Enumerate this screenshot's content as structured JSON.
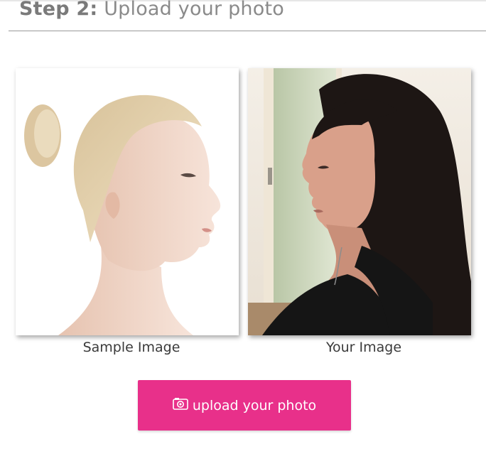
{
  "header": {
    "step_label": "Step 2:",
    "step_text": "Upload your photo"
  },
  "photos": {
    "sample": {
      "caption": "Sample Image",
      "image_alt": "Profile of a blonde woman with hair in a bun, facing right"
    },
    "yours": {
      "caption": "Your Image",
      "image_alt": "Profile of a dark-haired woman facing left in a room"
    }
  },
  "upload_button": {
    "label": "upload your photo",
    "icon": "camera-icon",
    "color": "#e8308a"
  }
}
